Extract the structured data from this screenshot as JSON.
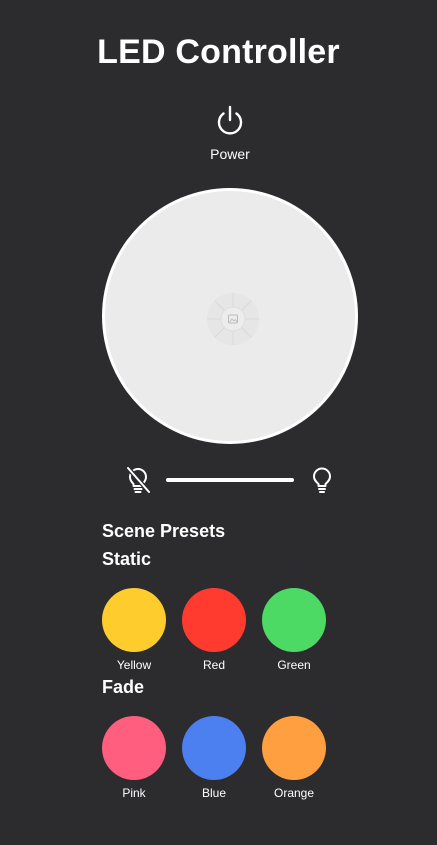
{
  "app": {
    "title": "LED Controller"
  },
  "power": {
    "label": "Power",
    "icon": "power-icon"
  },
  "color_wheel": {
    "icon": "color-picker-icon"
  },
  "brightness": {
    "min_icon": "bulb-off-icon",
    "max_icon": "bulb-icon"
  },
  "presets": {
    "heading": "Scene Presets",
    "static": {
      "heading": "Static",
      "items": [
        {
          "label": "Yellow",
          "color": "#FFCC2D"
        },
        {
          "label": "Red",
          "color": "#FF3B30"
        },
        {
          "label": "Green",
          "color": "#4CD964"
        }
      ]
    },
    "fade": {
      "heading": "Fade",
      "items": [
        {
          "label": "Pink",
          "color": "#FF5E7E"
        },
        {
          "label": "Blue",
          "color": "#4C7FF0"
        },
        {
          "label": "Orange",
          "color": "#FF9F40"
        }
      ]
    }
  },
  "colors": {
    "background": "#2C2B2D",
    "text": "#FFFFFF",
    "wheel": "#EBEBEB"
  }
}
